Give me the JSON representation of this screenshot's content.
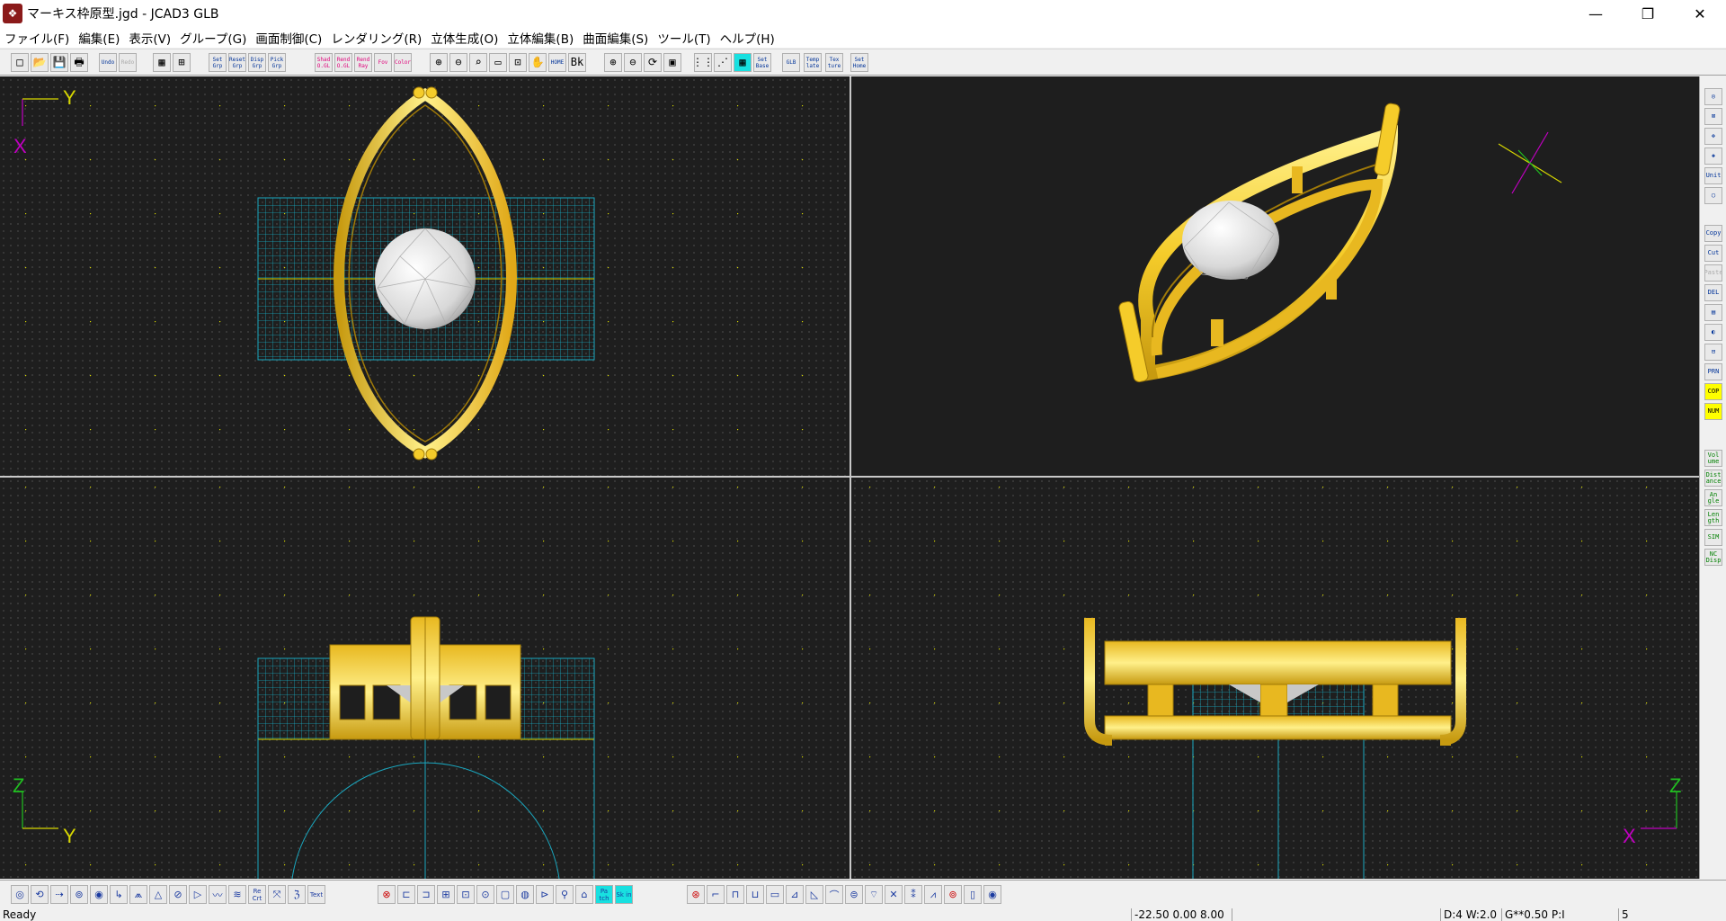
{
  "window": {
    "title": "マーキス枠原型.jgd - JCAD3 GLB",
    "minimize": "—",
    "maximize": "❐",
    "close": "✕"
  },
  "menu": [
    "ファイル(F)",
    "編集(E)",
    "表示(V)",
    "グループ(G)",
    "画面制御(C)",
    "レンダリング(R)",
    "立体生成(O)",
    "立体編集(B)",
    "曲面編集(S)",
    "ツール(T)",
    "ヘルプ(H)"
  ],
  "toolbar_top": [
    {
      "label": "□",
      "icon": "new-file-icon"
    },
    {
      "label": "📂",
      "icon": "open-folder-icon"
    },
    {
      "label": "💾",
      "icon": "save-icon"
    },
    {
      "label": "🖶",
      "icon": "print-icon"
    },
    {
      "label": "Undo",
      "icon": "undo-icon"
    },
    {
      "label": "Redo",
      "icon": "redo-icon",
      "disabled": true
    },
    {
      "label": "▦",
      "icon": "view-layout-icon"
    },
    {
      "label": "⊞",
      "icon": "four-view-icon"
    },
    {
      "label": "Set Grp",
      "icon": "set-group-icon"
    },
    {
      "label": "Reset Grp",
      "icon": "reset-group-icon"
    },
    {
      "label": "Disp Grp",
      "icon": "display-group-icon"
    },
    {
      "label": "Pick Grp",
      "icon": "pick-group-icon"
    },
    {
      "label": "Shad O.GL",
      "icon": "shade-opengl-icon",
      "pink": true
    },
    {
      "label": "Rend O.GL",
      "icon": "render-opengl-icon",
      "pink": true
    },
    {
      "label": "Rend Ray",
      "icon": "render-ray-icon",
      "pink": true
    },
    {
      "label": "Fov",
      "icon": "fov-icon",
      "pink": true
    },
    {
      "label": "Color",
      "icon": "color-icon",
      "pink": true
    },
    {
      "label": "⊕",
      "icon": "zoom-in-icon"
    },
    {
      "label": "⊖",
      "icon": "zoom-out-icon"
    },
    {
      "label": "⌕",
      "icon": "zoom-fit-icon"
    },
    {
      "label": "▭",
      "icon": "zoom-window-icon"
    },
    {
      "label": "⊡",
      "icon": "zoom-all-icon"
    },
    {
      "label": "✋",
      "icon": "pan-hand-icon"
    },
    {
      "label": "HOME",
      "icon": "home-view-icon"
    },
    {
      "label": "Bk",
      "icon": "back-view-icon"
    },
    {
      "label": "⊕",
      "icon": "zoom-in-red-icon",
      "pink": true
    },
    {
      "label": "⊖",
      "icon": "zoom-out-red-icon",
      "pink": true
    },
    {
      "label": "⟳",
      "icon": "rotate-view-icon"
    },
    {
      "label": "▣",
      "icon": "frame-view-icon"
    },
    {
      "label": "⋮⋮",
      "icon": "grid-dots-icon"
    },
    {
      "label": "⋰",
      "icon": "grid-snap-icon"
    },
    {
      "label": "▦",
      "icon": "grid-color-icon",
      "cyan": true
    },
    {
      "label": "Set Base",
      "icon": "set-base-icon"
    },
    {
      "label": "GLB",
      "icon": "glb-icon"
    },
    {
      "label": "Temp late",
      "icon": "template-icon"
    },
    {
      "label": "Tex ture",
      "icon": "texture-icon"
    },
    {
      "label": "Set Home",
      "icon": "set-home-icon"
    }
  ],
  "right_toolbar": [
    {
      "label": "◎",
      "icon": "light-icon"
    },
    {
      "label": "⊠",
      "icon": "camera-icon"
    },
    {
      "label": "✥",
      "icon": "move-icon"
    },
    {
      "label": "◈",
      "icon": "eye-icon"
    },
    {
      "label": "Unit",
      "icon": "unit-icon"
    },
    {
      "label": "◯",
      "icon": "circle-icon"
    },
    {
      "label": "Copy",
      "icon": "copy-icon"
    },
    {
      "label": "Cut",
      "icon": "cut-icon"
    },
    {
      "label": "Paste",
      "icon": "paste-icon",
      "disabled": true
    },
    {
      "label": "DEL",
      "icon": "delete-icon"
    },
    {
      "label": "▤",
      "icon": "list-icon"
    },
    {
      "label": "◐",
      "icon": "material-icon"
    },
    {
      "label": "⊟",
      "icon": "tree-icon"
    },
    {
      "label": "PRN",
      "icon": "print-small-icon"
    },
    {
      "label": "COP",
      "icon": "cop-icon",
      "yellow": true
    },
    {
      "label": "NUM",
      "icon": "num-icon",
      "yellow": true
    },
    {
      "label": "Vol ume",
      "icon": "volume-icon",
      "green": true
    },
    {
      "label": "Dist ance",
      "icon": "distance-icon",
      "green": true
    },
    {
      "label": "An gle",
      "icon": "angle-icon",
      "green": true
    },
    {
      "label": "Len gth",
      "icon": "length-icon",
      "green": true
    },
    {
      "label": "SIM",
      "icon": "sim-icon",
      "green": true
    },
    {
      "label": "NC Disp",
      "icon": "nc-display-icon",
      "green": true
    }
  ],
  "toolbar_bottom": [
    {
      "label": "◎",
      "icon": "point-icon"
    },
    {
      "label": "⟲",
      "icon": "curve-icon"
    },
    {
      "label": "⇢",
      "icon": "line-icon"
    },
    {
      "label": "⊚",
      "icon": "arc-icon"
    },
    {
      "label": "◉",
      "icon": "ellipse-icon"
    },
    {
      "label": "↳",
      "icon": "offset-icon"
    },
    {
      "label": "⩕",
      "icon": "trim-icon"
    },
    {
      "label": "△",
      "icon": "polygon-icon"
    },
    {
      "label": "⊘",
      "icon": "fillet-icon"
    },
    {
      "label": "▷",
      "icon": "extend-icon"
    },
    {
      "label": "〰",
      "icon": "wave-icon"
    },
    {
      "label": "≋",
      "icon": "spring-icon"
    },
    {
      "label": "Re Crt",
      "icon": "recreate-icon"
    },
    {
      "label": "⤧",
      "icon": "scale-icon"
    },
    {
      "label": "ℨ",
      "icon": "spiral-icon"
    },
    {
      "label": "Text",
      "icon": "text-icon"
    },
    {
      "label": "⊗",
      "icon": "rotate-solid-icon",
      "red": true
    },
    {
      "label": "⊏",
      "icon": "extrude-icon"
    },
    {
      "label": "⊐",
      "icon": "sweep-icon"
    },
    {
      "label": "⊞",
      "icon": "loft-icon"
    },
    {
      "label": "⊡",
      "icon": "box-icon"
    },
    {
      "label": "⊙",
      "icon": "sphere-icon"
    },
    {
      "label": "▢",
      "icon": "cube-icon"
    },
    {
      "label": "◍",
      "icon": "cylinder-icon"
    },
    {
      "label": "⊳",
      "icon": "cone-icon"
    },
    {
      "label": "⚲",
      "icon": "ring-icon"
    },
    {
      "label": "⌂",
      "icon": "house-icon"
    },
    {
      "label": "Pa tch",
      "icon": "patch-icon",
      "cyan": true
    },
    {
      "label": "Sk in",
      "icon": "skin-icon",
      "cyan": true
    },
    {
      "label": "⊛",
      "icon": "boolean-icon",
      "red": true
    },
    {
      "label": "⌐",
      "icon": "corner-icon"
    },
    {
      "label": "⊓",
      "icon": "step-icon"
    },
    {
      "label": "⊔",
      "icon": "channel-icon"
    },
    {
      "label": "▭",
      "icon": "rect-solid-icon"
    },
    {
      "label": "⊿",
      "icon": "wedge-icon"
    },
    {
      "label": "◺",
      "icon": "chamfer-icon"
    },
    {
      "label": "⌒",
      "icon": "bend-icon"
    },
    {
      "label": "⊜",
      "icon": "twist-icon"
    },
    {
      "label": "⌔",
      "icon": "taper-icon"
    },
    {
      "label": "✕",
      "icon": "mirror-icon"
    },
    {
      "label": "⁑",
      "icon": "array-icon"
    },
    {
      "label": "⩘",
      "icon": "deform-icon"
    },
    {
      "label": "⊚",
      "icon": "gem-setting-icon",
      "red": true
    },
    {
      "label": "▯",
      "icon": "section-icon"
    },
    {
      "label": "◉",
      "icon": "view-eye-icon"
    }
  ],
  "status": {
    "ready": "Ready",
    "coords": "-22.50 0.00 8.00",
    "blank": "",
    "depth": "D:4 W:2.0",
    "grid": "G**0.50 P:I",
    "count": "5"
  },
  "views": {
    "top": {
      "axis_h": "Y",
      "axis_v": "X"
    },
    "front": {
      "axis_v": "Z",
      "axis_h": "Y"
    },
    "side": {
      "axis_v": "Z",
      "axis_h": "X"
    }
  },
  "colors": {
    "gold": "#f5cc2a",
    "gold_dark": "#c79a10",
    "gold_light": "#fff08a",
    "grid_cyan": "#1aa8c0",
    "axis_yellow": "#d8d800",
    "axis_magenta": "#c000c0",
    "axis_green": "#20c020",
    "gem": "#e8e8e8"
  }
}
